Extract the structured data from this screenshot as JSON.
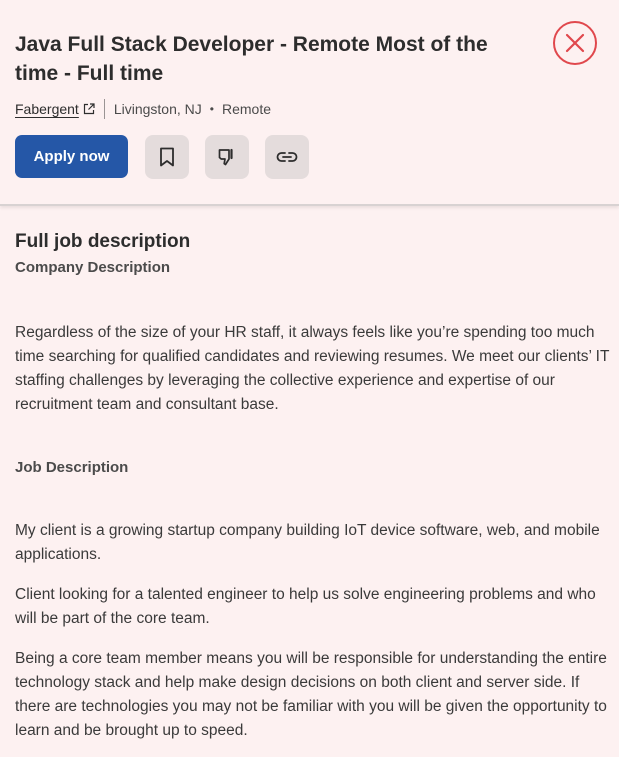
{
  "job": {
    "title": "Java Full Stack Developer - Remote Most of the time - Full time",
    "company": "Fabergent",
    "location": "Livingston, NJ",
    "dot": "•",
    "work_type": "Remote"
  },
  "actions": {
    "apply_label": "Apply now"
  },
  "icons": {
    "close": "close-icon",
    "external_link": "external-link-icon",
    "save": "bookmark-icon",
    "not_interested": "thumbs-down-icon",
    "copy_link": "link-icon"
  },
  "colors": {
    "accent": "#2557a7",
    "close": "#e0484d",
    "background": "#fdf1f1"
  },
  "description": {
    "heading": "Full job description",
    "company_heading": "Company Description",
    "company_text": "Regardless of the size of your HR staff, it always feels like you’re spending too much time searching for qualified candidates and reviewing resumes. We meet our clients’ IT staffing challenges by leveraging the collective experience and expertise of our recruitment team and consultant base.",
    "job_heading": "Job Description",
    "job_paragraphs": [
      "My client is a growing startup company building IoT device software, web, and mobile applications.",
      "Client looking for a talented engineer to help us solve engineering problems and who will be part of the core team.",
      "Being a core team member means you will be responsible for understanding the entire technology stack and help make design decisions on both client and server side. If there are technologies you may not be familiar with you will be given the opportunity to learn and be brought up to speed."
    ]
  }
}
